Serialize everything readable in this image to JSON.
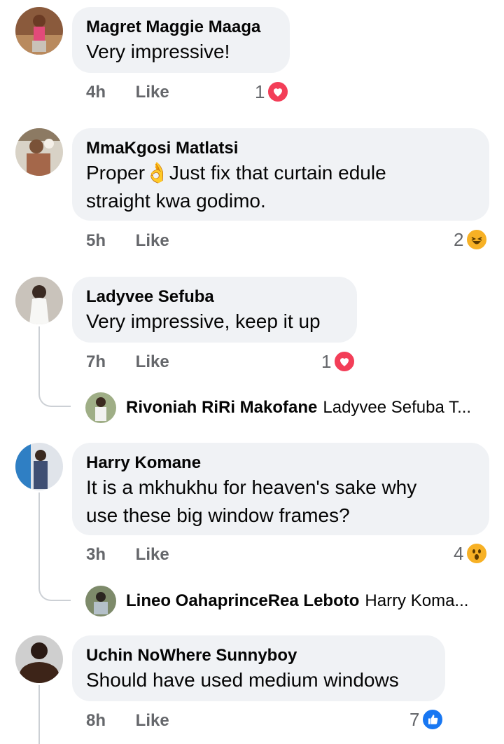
{
  "comments": [
    {
      "author": "Magret Maggie Maaga",
      "text": "Very impressive!",
      "time": "4h",
      "like": "Like",
      "reaction_count": "1",
      "reaction": "love"
    },
    {
      "author": "MmaKgosi Matlatsi",
      "text_before": "Proper",
      "text_emoji": "👌",
      "text_after": "Just fix that curtain edule",
      "text_line2": "straight kwa godimo.",
      "time": "5h",
      "like": "Like",
      "reaction_count": "2",
      "reaction": "haha"
    },
    {
      "author": "Ladyvee Sefuba",
      "text": "Very impressive, keep it up",
      "time": "7h",
      "like": "Like",
      "reaction_count": "1",
      "reaction": "love",
      "reply": {
        "author": "Rivoniah RiRi Makofane",
        "preview": "Ladyvee Sefuba T..."
      }
    },
    {
      "author": "Harry Komane",
      "text_line1": "It is a mkhukhu for heaven's sake why",
      "text_line2": "use these big window frames?",
      "time": "3h",
      "like": "Like",
      "reaction_count": "4",
      "reaction": "wow",
      "reply": {
        "author": "Lineo OahaprinceRea Leboto",
        "preview": "Harry Koma..."
      }
    },
    {
      "author": "Uchin NoWhere Sunnyboy",
      "text": "Should have used medium windows",
      "time": "8h",
      "like": "Like",
      "reaction_count": "7",
      "reaction": "like"
    }
  ],
  "colors": {
    "bubble": "#f0f2f5",
    "meta": "#65676b",
    "love": "#f33e58",
    "haha": "#f7b125",
    "like": "#1877f2",
    "line": "#ccd0d5"
  }
}
